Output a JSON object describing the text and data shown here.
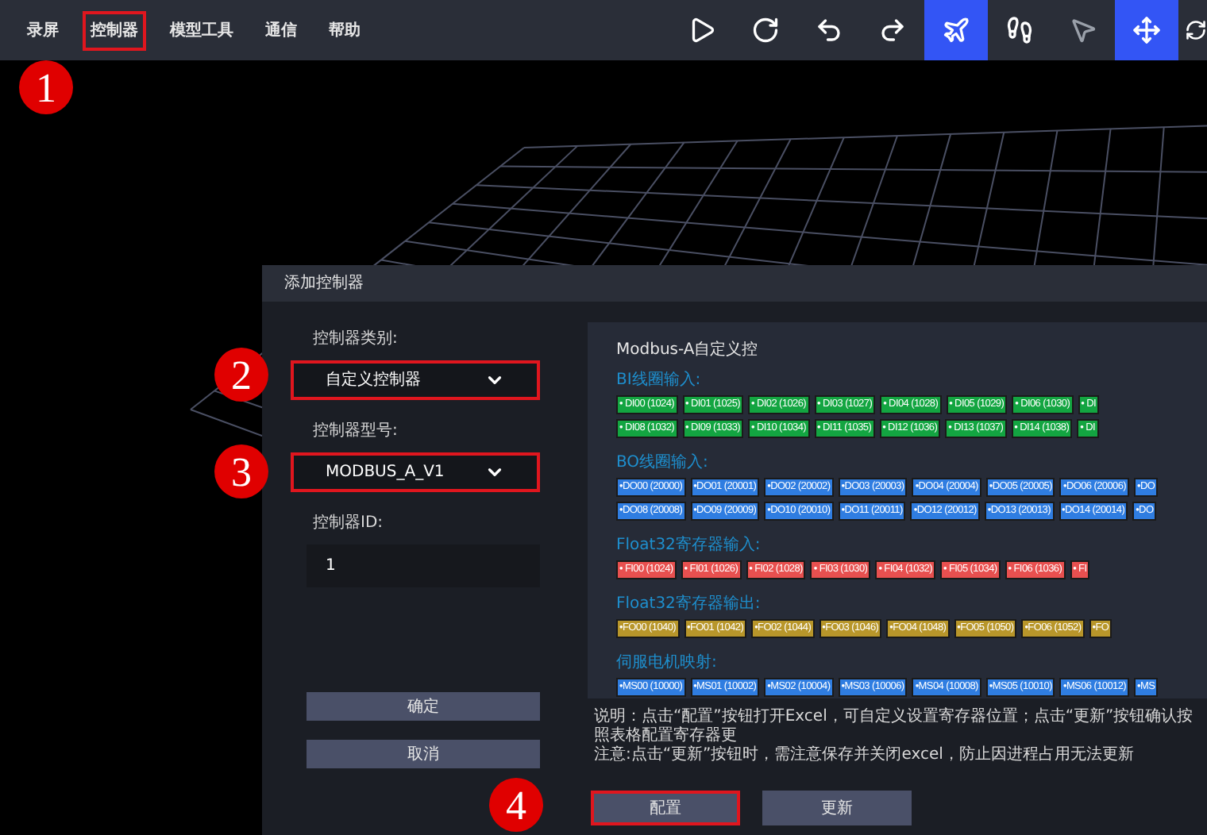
{
  "menu": [
    {
      "label": "录屏",
      "highlighted": false
    },
    {
      "label": "控制器",
      "highlighted": true
    },
    {
      "label": "模型工具",
      "highlighted": false
    },
    {
      "label": "通信",
      "highlighted": false
    },
    {
      "label": "帮助",
      "highlighted": false
    }
  ],
  "toolbar": [
    {
      "selected": false
    },
    {
      "selected": false
    },
    {
      "selected": false
    },
    {
      "selected": false
    },
    {
      "selected": true
    },
    {
      "selected": false
    },
    {
      "selected": false
    },
    {
      "selected": true
    },
    {
      "selected": false
    }
  ],
  "dialog": {
    "title": "添加控制器",
    "fields": [
      {
        "kind": "select",
        "label": "控制器类别:",
        "value": "自定义控制器",
        "highlighted": true
      },
      {
        "kind": "select",
        "label": "控制器型号:",
        "value": "MODBUS_A_V1",
        "highlighted": true
      },
      {
        "kind": "input",
        "label": "控制器ID:",
        "value": "1",
        "highlighted": false
      }
    ],
    "buttons": [
      {
        "label": "确定"
      },
      {
        "label": "取消"
      }
    ],
    "panel": {
      "title": "Modbus-A自定义控",
      "sections": [
        {
          "title": "BI线圈输入:",
          "color": "#13a541",
          "rows": [
            [
              "• DI00 (1024)",
              "• DI01 (1025)",
              "• DI02 (1026)",
              "• DI03 (1027)",
              "• DI04 (1028)",
              "• DI05 (1029)",
              "• DI06 (1030)",
              "• DI"
            ],
            [
              "• DI08 (1032)",
              "• DI09 (1033)",
              "• DI10 (1034)",
              "• DI11 (1035)",
              "• DI12 (1036)",
              "• DI13 (1037)",
              "• DI14 (1038)",
              "• DI"
            ]
          ]
        },
        {
          "title": "BO线圈输入:",
          "color": "#2f7de1",
          "rows": [
            [
              "•DO00 (20000)",
              "•DO01 (20001)",
              "•DO02 (20002)",
              "•DO03 (20003)",
              "•DO04 (20004)",
              "•DO05 (20005)",
              "•DO06 (20006)",
              "•DO"
            ],
            [
              "•DO08 (20008)",
              "•DO09 (20009)",
              "•DO10 (20010)",
              "•DO11 (20011)",
              "•DO12 (20012)",
              "•DO13 (20013)",
              "•DO14 (20014)",
              "•DO"
            ]
          ]
        },
        {
          "title": "Float32寄存器输入:",
          "color": "#e8504f",
          "rows": [
            [
              "• FI00 (1024)",
              "• FI01 (1026)",
              "• FI02 (1028)",
              "• FI03 (1030)",
              "• FI04 (1032)",
              "• FI05 (1034)",
              "• FI06 (1036)",
              "• FI"
            ]
          ]
        },
        {
          "title": "Float32寄存器输出:",
          "color": "#b8962a",
          "rows": [
            [
              "•FO00 (1040)",
              "•FO01 (1042)",
              "•FO02 (1044)",
              "•FO03 (1046)",
              "•FO04 (1048)",
              "•FO05 (1050)",
              "•FO06 (1052)",
              "•FO"
            ]
          ]
        },
        {
          "title": "伺服电机映射:",
          "color": "#2f7de1",
          "rows": [
            [
              "•MS00 (10000)",
              "•MS01 (10002)",
              "•MS02 (10004)",
              "•MS03 (10006)",
              "•MS04 (10008)",
              "•MS05 (10010)",
              "•MS06 (10012)",
              "•MS"
            ]
          ]
        }
      ]
    },
    "notes": [
      "说明：点击“配置”按钮打开Excel，可自定义设置寄存器位置；点击“更新”按钮确认按照表格配置寄存器更",
      "注意:点击“更新”按钮时，需注意保存并关闭excel，防止因进程占用无法更新"
    ],
    "footer_buttons": [
      {
        "label": "配置",
        "highlighted": true
      },
      {
        "label": "更新",
        "highlighted": false
      }
    ]
  },
  "annotations": [
    "1",
    "2",
    "3",
    "4"
  ]
}
